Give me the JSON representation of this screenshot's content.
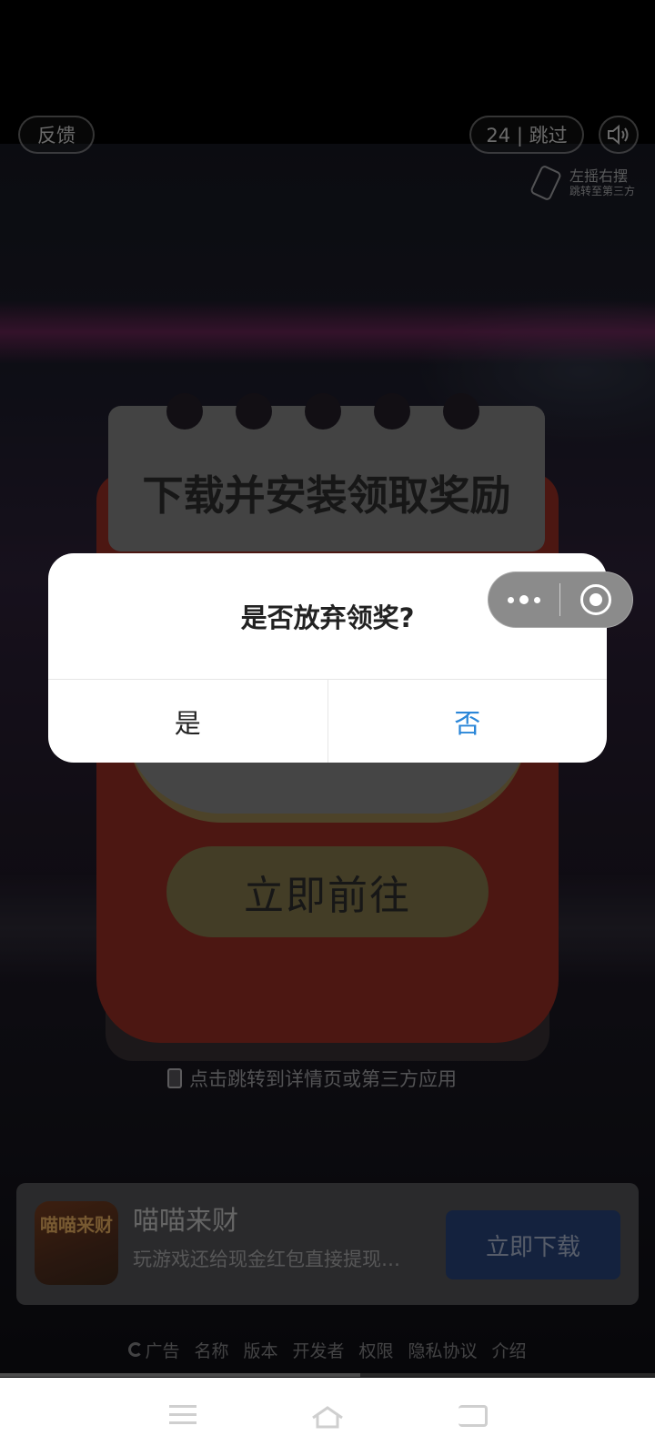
{
  "ad": {
    "feedback_label": "反馈",
    "skip_label": "24 | 跳过",
    "shake_title": "左摇右摆",
    "shake_subtitle": "跳转至第三方",
    "card_title": "下载并安装领取奖励",
    "go_button": "立即前往",
    "hint": "点击跳转到详情页或第三方应用"
  },
  "app": {
    "icon_text": "喵喵来财",
    "name": "喵喵来财",
    "description": "玩游戏还给现金红包直接提现…",
    "download_button": "立即下载"
  },
  "ad_links": [
    "广告",
    "名称",
    "版本",
    "开发者",
    "权限",
    "隐私协议",
    "介绍"
  ],
  "progress": {
    "fraction": 0.55
  },
  "dialog": {
    "title": "是否放弃领奖?",
    "confirm": "是",
    "cancel": "否",
    "cancel_color": "#2a86d8"
  },
  "icons": {
    "sound": "speaker-icon",
    "capsule_more": "more-dots-icon",
    "capsule_close": "close-target-icon"
  }
}
